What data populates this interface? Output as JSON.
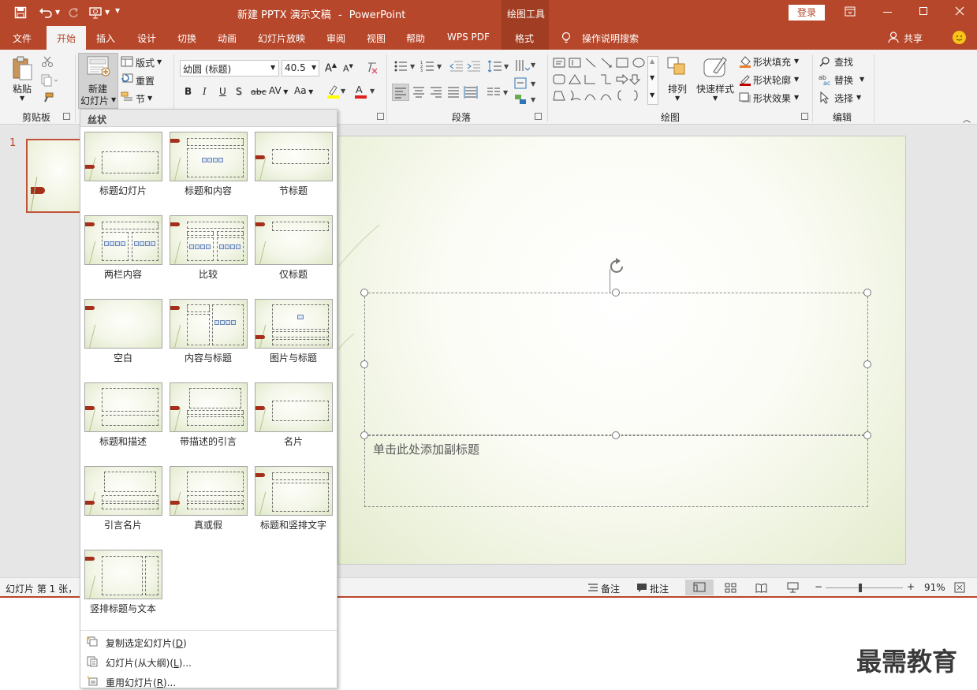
{
  "window": {
    "doc_title": "新建 PPTX 演示文稿",
    "app_name": "PowerPoint",
    "separator": "-",
    "context_group": "绘图工具",
    "login_label": "登录",
    "share_label": "共享"
  },
  "tabs": [
    "文件",
    "开始",
    "插入",
    "设计",
    "切换",
    "动画",
    "幻灯片放映",
    "审阅",
    "视图",
    "帮助",
    "WPS PDF",
    "格式"
  ],
  "tell_me": "操作说明搜索",
  "ribbon": {
    "clipboard": {
      "paste": "粘贴",
      "group": "剪贴板"
    },
    "slides": {
      "new_line1": "新建",
      "new_line2": "幻灯片",
      "layout": "版式",
      "reset": "重置",
      "section": "节"
    },
    "font": {
      "name": "幼圆 (标题)",
      "size": "40.5",
      "bold": "B",
      "italic": "I",
      "underline": "U",
      "shadow": "S",
      "strike": "abc",
      "spacing": "AV",
      "case": "Aa",
      "grow": "A",
      "shrink": "A"
    },
    "paragraph": {
      "group": "段落"
    },
    "drawing": {
      "arrange": "排列",
      "quick_styles": "快速样式",
      "fill": "形状填充",
      "outline": "形状轮廓",
      "effects": "形状效果",
      "group": "绘图"
    },
    "editing": {
      "find": "查找",
      "replace": "替换",
      "select": "选择",
      "group": "编辑"
    }
  },
  "slide_panel": {
    "number": "1"
  },
  "slide": {
    "subtitle_placeholder": "单击此处添加副标题"
  },
  "gallery": {
    "header": "丝状",
    "layouts": [
      "标题幻灯片",
      "标题和内容",
      "节标题",
      "两栏内容",
      "比较",
      "仅标题",
      "空白",
      "内容与标题",
      "图片与标题",
      "标题和描述",
      "带描述的引言",
      "名片",
      "引言名片",
      "真或假",
      "标题和竖排文字",
      "竖排标题与文本"
    ],
    "menu": [
      {
        "text": "复制选定幻灯片(",
        "key": "D",
        "tail": ")"
      },
      {
        "text": "幻灯片(从大纲)(",
        "key": "L",
        "tail": ")..."
      },
      {
        "text": "重用幻灯片(",
        "key": "R",
        "tail": ")..."
      }
    ]
  },
  "status": {
    "slide_info": "幻灯片 第 1 张，",
    "notes": "备注",
    "comments": "批注",
    "zoom": "91%",
    "zoom_minus": "−",
    "zoom_plus": "+"
  },
  "watermark": "最需教育",
  "colors": {
    "accent": "#b7472a",
    "tag": "#a4301c"
  }
}
